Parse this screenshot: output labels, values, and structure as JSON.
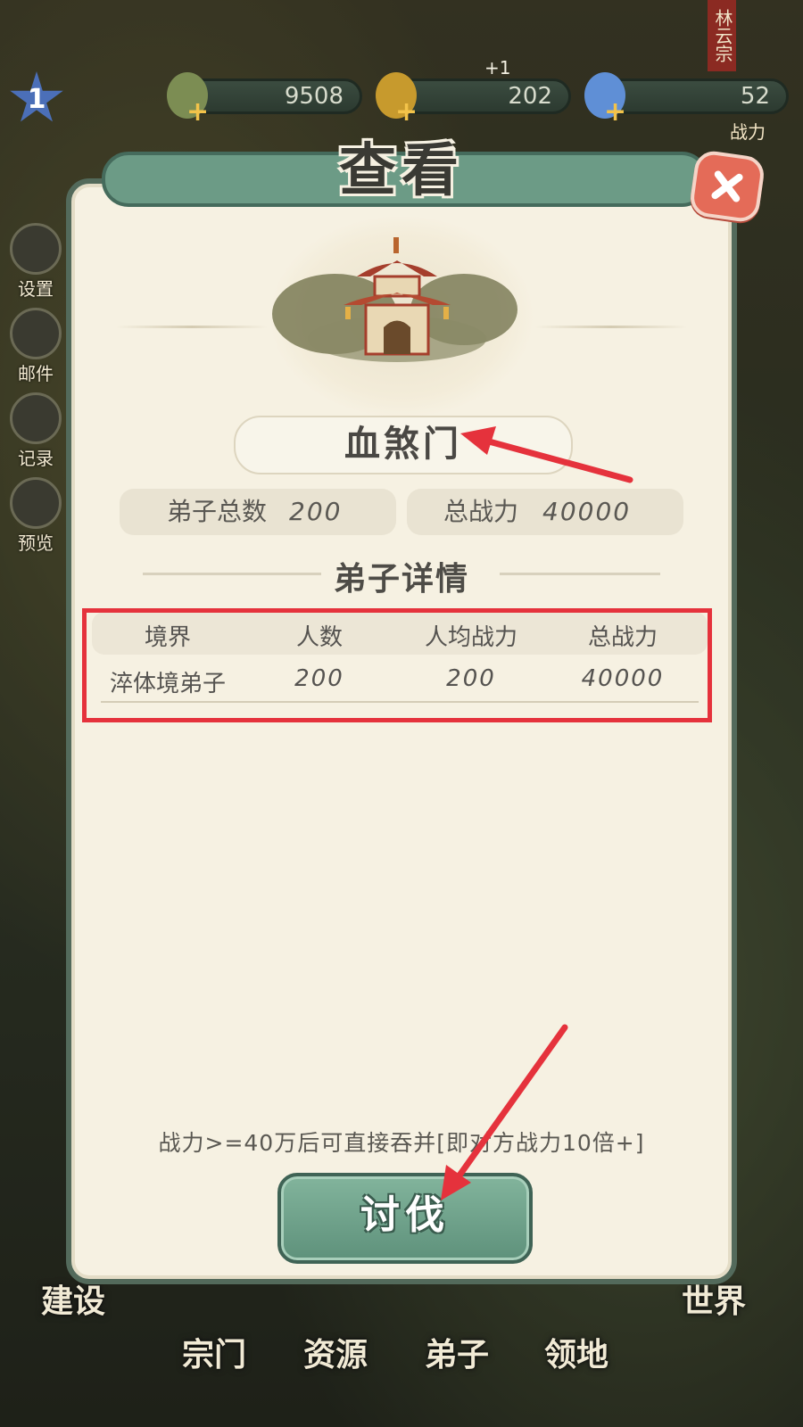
{
  "topbar": {
    "level": "1",
    "resources": [
      {
        "name": "herb",
        "value": "9508",
        "color": "#7c8d53"
      },
      {
        "name": "ore",
        "value": "202",
        "color": "#c79a2d"
      },
      {
        "name": "crystal",
        "value": "52",
        "color": "#5f8fd6"
      }
    ],
    "ore_bonus": "+1",
    "clan_tag": "林云宗",
    "power_label": "战力"
  },
  "side_menu": [
    {
      "label": "设置",
      "icon": "gear-icon"
    },
    {
      "label": "邮件",
      "icon": "mail-icon"
    },
    {
      "label": "记录",
      "icon": "record-icon"
    },
    {
      "label": "预览",
      "icon": "preview-icon"
    }
  ],
  "modal": {
    "title": "查看",
    "sect_name": "血煞门",
    "stats": {
      "disciples_label": "弟子总数",
      "disciples_value": "200",
      "power_label": "总战力",
      "power_value": "40000"
    },
    "section_title": "弟子详情",
    "table": {
      "headers": [
        "境界",
        "人数",
        "人均战力",
        "总战力"
      ],
      "rows": [
        [
          "淬体境弟子",
          "200",
          "200",
          "40000"
        ]
      ]
    },
    "hint": "战力>=40万后可直接吞并[即对方战力10倍+]",
    "action_label": "讨伐"
  },
  "bottom_nav": [
    {
      "label": "建设"
    },
    {
      "label": "宗门"
    },
    {
      "label": "资源"
    },
    {
      "label": "弟子"
    },
    {
      "label": "领地"
    },
    {
      "label": "世界"
    }
  ],
  "colors": {
    "accent_green": "#6c9b86",
    "close_red": "#e46b58",
    "annotation_red": "#e5323c"
  }
}
